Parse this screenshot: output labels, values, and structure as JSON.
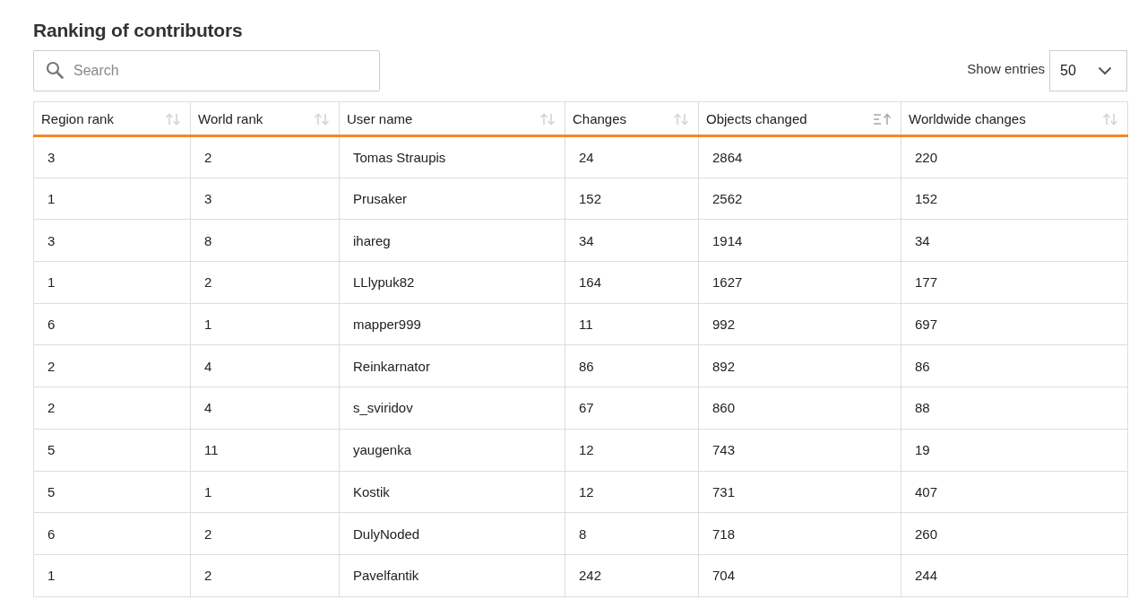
{
  "title": "Ranking of contributors",
  "search": {
    "placeholder": "Search"
  },
  "entries": {
    "label": "Show entries",
    "value": "50"
  },
  "table": {
    "columns": [
      {
        "label": "Region rank",
        "sorted": false
      },
      {
        "label": "World rank",
        "sorted": false
      },
      {
        "label": "User name",
        "sorted": false
      },
      {
        "label": "Changes",
        "sorted": false
      },
      {
        "label": "Objects changed",
        "sorted": true
      },
      {
        "label": "Worldwide changes",
        "sorted": false
      }
    ],
    "rows": [
      [
        "3",
        "2",
        "Tomas Straupis",
        "24",
        "2864",
        "220"
      ],
      [
        "1",
        "3",
        "Prusaker",
        "152",
        "2562",
        "152"
      ],
      [
        "3",
        "8",
        "ihareg",
        "34",
        "1914",
        "34"
      ],
      [
        "1",
        "2",
        "LLlypuk82",
        "164",
        "1627",
        "177"
      ],
      [
        "6",
        "1",
        "mapper999",
        "11",
        "992",
        "697"
      ],
      [
        "2",
        "4",
        "Reinkarnator",
        "86",
        "892",
        "86"
      ],
      [
        "2",
        "4",
        "s_sviridov",
        "67",
        "860",
        "88"
      ],
      [
        "5",
        "11",
        "yaugenka",
        "12",
        "743",
        "19"
      ],
      [
        "5",
        "1",
        "Kostik",
        "12",
        "731",
        "407"
      ],
      [
        "6",
        "2",
        "DulyNoded",
        "8",
        "718",
        "260"
      ],
      [
        "1",
        "2",
        "Pavelfantik",
        "242",
        "704",
        "244"
      ]
    ]
  }
}
